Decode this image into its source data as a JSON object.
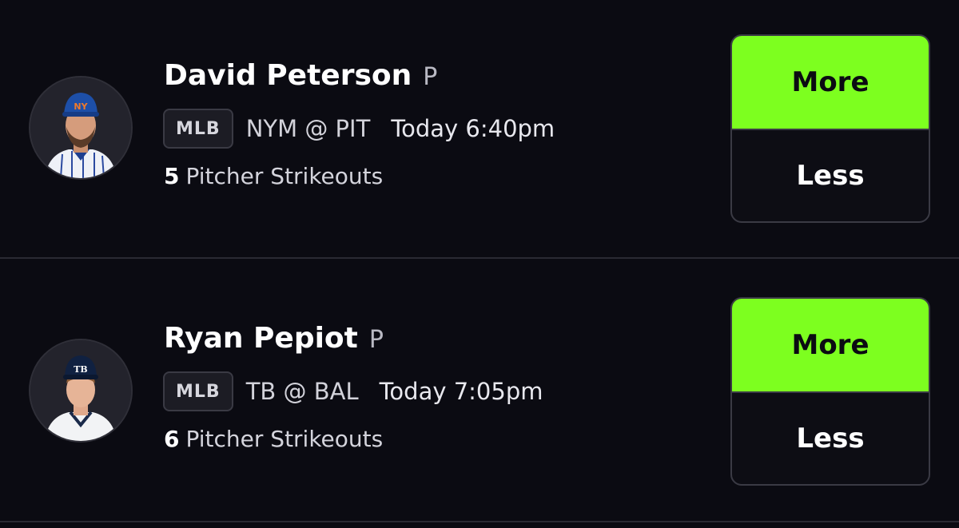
{
  "accent_color": "#7dff1f",
  "picks": [
    {
      "player_name": "David Peterson",
      "position": "P",
      "league": "MLB",
      "matchup": "NYM @ PIT",
      "game_time": "Today 6:40pm",
      "stat_line": "5",
      "stat_name": "Pitcher Strikeouts",
      "more_label": "More",
      "less_label": "Less",
      "avatar_icon": "player-headshot-mets"
    },
    {
      "player_name": "Ryan Pepiot",
      "position": "P",
      "league": "MLB",
      "matchup": "TB @ BAL",
      "game_time": "Today 7:05pm",
      "stat_line": "6",
      "stat_name": "Pitcher Strikeouts",
      "more_label": "More",
      "less_label": "Less",
      "avatar_icon": "player-headshot-rays"
    }
  ]
}
